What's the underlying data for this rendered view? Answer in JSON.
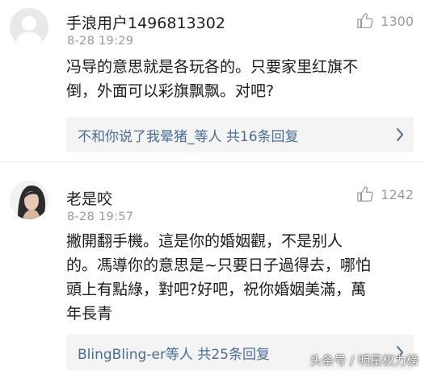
{
  "comments": [
    {
      "username": "手浪用户1496813302",
      "time": "8-28 19:29",
      "likes": "1300",
      "text": "冯导的意思就是各玩各的。只要家里红旗不\n倒，外面可以彩旗飘飘。对吧?",
      "replies": "不和你说了我晕猪_等人  共16条回复"
    },
    {
      "username": "老是咬",
      "time": "8-28 19:57",
      "likes": "1242",
      "text": "撇開翻手機。這是你的婚姻觀，不是别人\n的。馮導你的意思是~只要日子過得去，哪怕\n頭上有點綠，對吧?好吧，祝你婚姻美滿，萬\n年長青",
      "replies": "BlingBling-er等人  共25条回复"
    }
  ],
  "icons": {
    "like": "thumbs-up-icon",
    "expand": "chevron-right-icon",
    "avatar_default": "default-avatar-icon"
  },
  "watermark": "头条号 / 明星权力榜",
  "colors": {
    "reply_link": "#4a6d97",
    "meta": "#9a9a9a"
  }
}
